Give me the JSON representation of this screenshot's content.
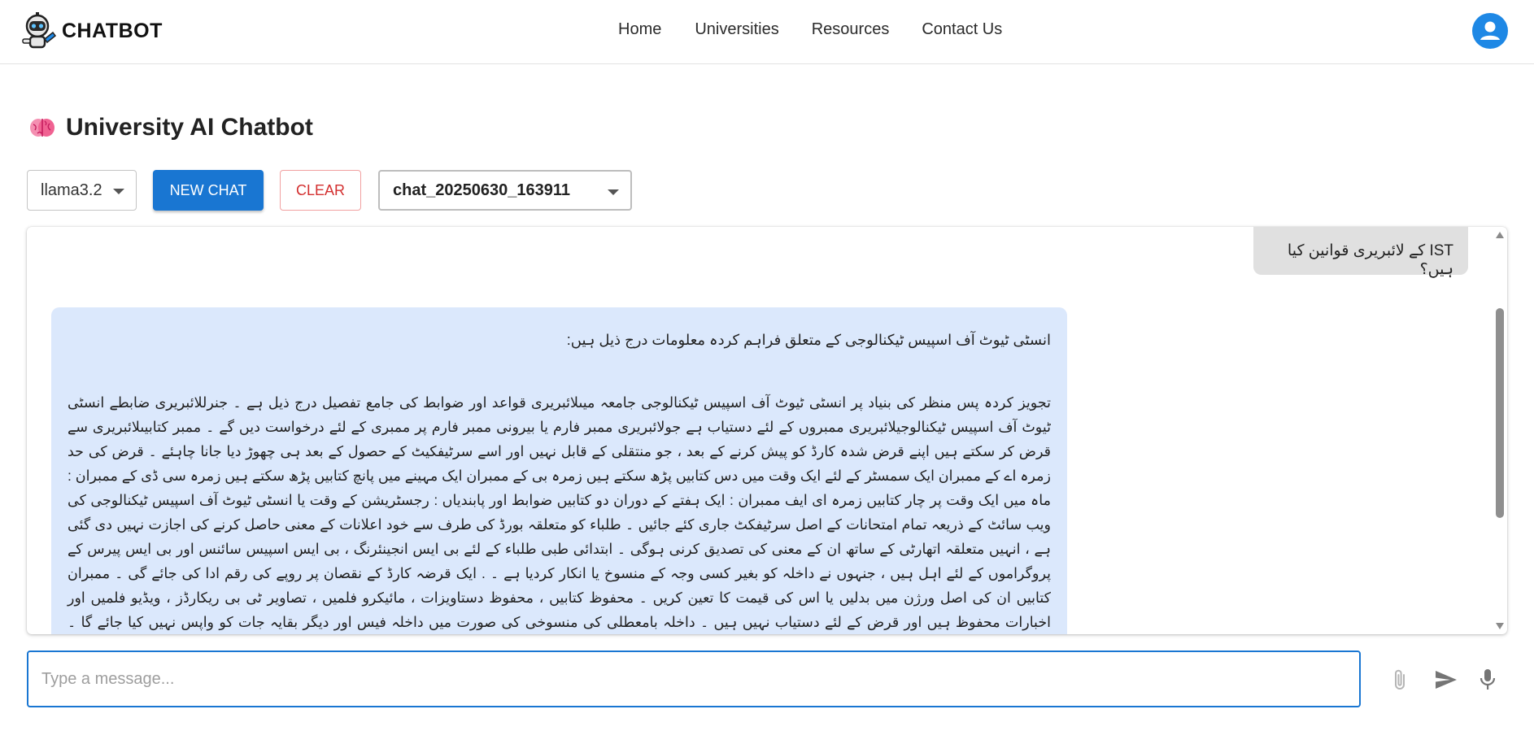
{
  "navbar": {
    "brand": "CHATBOT",
    "links": [
      "Home",
      "Universities",
      "Resources",
      "Contact Us"
    ],
    "avatar_icon": "account-circle-icon"
  },
  "page": {
    "title_emoji": "🧠",
    "title": "University AI Chatbot"
  },
  "controls": {
    "model": "llama3.2",
    "new_chat_label": "NEW CHAT",
    "clear_label": "CLEAR",
    "session": "chat_20250630_163911"
  },
  "chat": {
    "user_message": "IST کے لائبریری قوانین کیا ہیں؟",
    "bot_intro": "انسٹی ٹیوٹ آف اسپیس ٹیکنالوجی کے متعلق فراہم کردہ معلومات درج ذیل ہیں:",
    "bot_body": "تجویز کردہ پس منظر کی بنیاد پر انسٹی ٹیوٹ آف اسپیس ٹیکنالوجی جامعہ میںلائبریری قواعد اور ضوابط کی جامع تفصیل درج ذیل ہے ۔ جنرللائبریری ضابطے انسٹی ٹیوٹ آف اسپیس ٹیکنالوجیلائبریری ممبروں کے لئے دستیاب ہے جولائبریری ممبر فارم یا بیرونی ممبر فارم پر ممبری کے لئے درخواست دیں گے ۔ ممبر کتابیںلائبریری سے قرض کر سکتے ہیں اپنے قرض شدہ کارڈ کو پیش کرنے کے بعد ، جو منتقلی کے قابل نہیں اور اسے سرٹیفکیٹ کے حصول کے بعد ہی چھوڑ دیا جانا چاہئے ۔ قرض کی حد زمرہ اے کے ممبران ایک سمسٹر کے لئے ایک وقت میں دس کتابیں پڑھ سکتے ہیں زمرہ بی کے ممبران ایک مہینے میں پانچ کتابیں پڑھ سکتے ہیں زمرہ سی ڈی کے ممبران : ماہ میں ایک وقت پر چار کتابیں زمرہ ای ایف ممبران : ایک ہفتے کے دوران دو کتابیں ضوابط اور پابندیاں : رجسٹریشن کے وقت یا انسٹی ٹیوٹ آف اسپیس ٹیکنالوجی کی ویب سائٹ کے ذریعہ تمام امتحانات کے اصل سرٹیفکٹ جاری کئے جائیں ۔ طلباء کو متعلقہ بورڈ کی طرف سے خود اعلانات کے معنی حاصل کرنے کی اجازت نہیں دی گئی ہے ، انہیں متعلقہ اتھارٹی کے ساتھ ان کے معنی کی تصدیق کرنی ہوگی ۔ ابتدائی طبی طلباء کے لئے بی ایس انجینئرنگ ، بی ایس اسپیس سائنس اور بی ایس پیرس کے پروگراموں کے لئے اہل ہیں ، جنہوں نے داخلہ کو بغیر کسی وجہ کے منسوخ یا انکار کردیا ہے ۔ . ایک قرضہ کارڈ کے نقصان پر روپے کی رقم ادا کی جائے گی ۔ ممبران کتابیں ان کی اصل ورژن میں بدلیں یا اس کی قیمت کا تعین کریں ۔ محفوظ کتابیں ، محفوظ دستاویزات ، مائیکرو فلمیں ، تصاویر ٹی بی ریکارڈز ، ویڈیو فلمیں اور اخبارات محفوظ ہیں اور قرض کے لئے دستیاب نہیں ہیں ۔ داخلہ بامعطلی کی منسوخی کی صورت میں داخلہ فیس اور دیگر بقایہ جات کو واپس نہیں کیا جائے گا ۔ جرمانونکی تعداد اگر داخلے کے دفتر کے ذریعے موصولہ دستاویز"
  },
  "composer": {
    "placeholder": "Type a message...",
    "attach_icon": "paperclip-icon",
    "send_icon": "send-icon",
    "mic_icon": "microphone-icon"
  },
  "colors": {
    "primary": "#1976d2",
    "avatar": "#1e88e5",
    "danger": "#d32f2f",
    "bot_bubble": "#dbe8fc",
    "user_bubble": "#e0e0e0"
  }
}
